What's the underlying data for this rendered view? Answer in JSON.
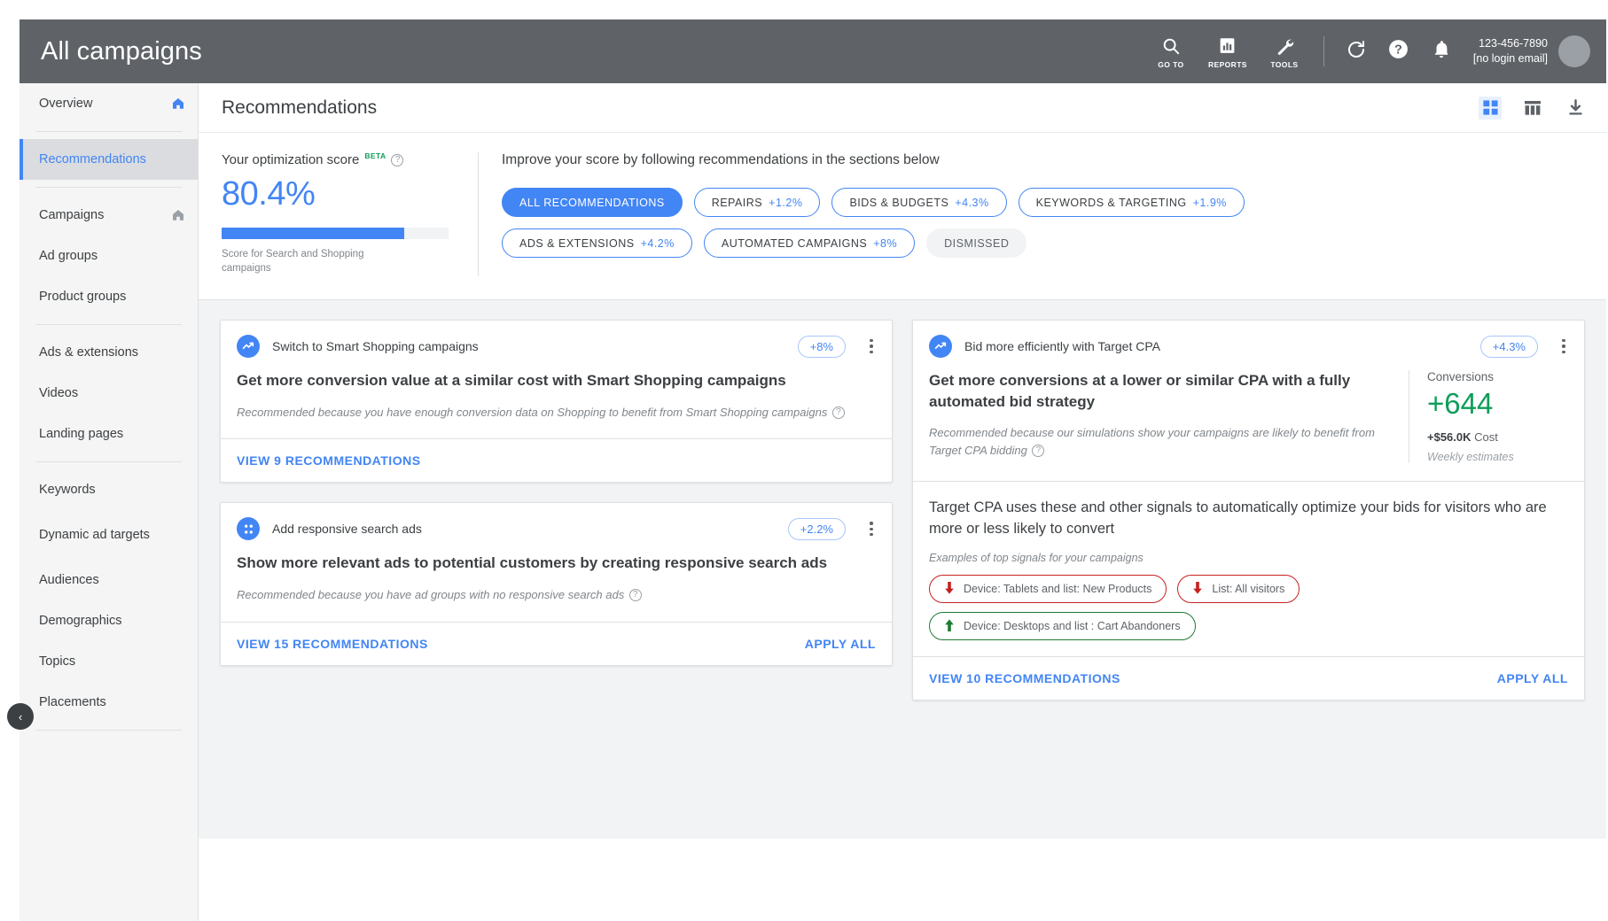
{
  "topbar": {
    "title": "All campaigns",
    "icon_buttons": [
      {
        "icon": "search-icon",
        "label": "GO TO"
      },
      {
        "icon": "reports-bar-chart-icon",
        "label": "REPORTS"
      },
      {
        "icon": "wrench-tools-icon",
        "label": "TOOLS"
      }
    ],
    "refresh_icon": "refresh-icon",
    "help_icon": "help-circle-icon",
    "notifications_icon": "bell-icon",
    "account_id": "123-456-7890",
    "account_email": "[no login email]"
  },
  "sidebar": {
    "items": [
      {
        "label": "Overview",
        "icon": "home-icon",
        "icon_active": true,
        "active": false,
        "sep_after": true
      },
      {
        "label": "Recommendations",
        "icon": "",
        "active": true,
        "sep_after": true
      },
      {
        "label": "Campaigns",
        "icon": "home-icon",
        "icon_active": false,
        "active": false
      },
      {
        "label": "Ad groups",
        "icon": "",
        "active": false
      },
      {
        "label": "Product groups",
        "icon": "",
        "active": false,
        "sep_after": true
      },
      {
        "label": "Ads & extensions",
        "icon": "",
        "active": false
      },
      {
        "label": "Videos",
        "icon": "",
        "active": false
      },
      {
        "label": "Landing pages",
        "icon": "",
        "active": false,
        "sep_after": true
      },
      {
        "label": "Keywords",
        "icon": "",
        "active": false
      },
      {
        "label": "Dynamic ad targets",
        "icon": "",
        "active": false,
        "tall": true
      },
      {
        "label": "Audiences",
        "icon": "",
        "active": false
      },
      {
        "label": "Demographics",
        "icon": "",
        "active": false
      },
      {
        "label": "Topics",
        "icon": "",
        "active": false
      },
      {
        "label": "Placements",
        "icon": "",
        "active": false,
        "sep_after": true
      }
    ],
    "collapse_toggle": "‹"
  },
  "page_header": {
    "title": "Recommendations",
    "actions": [
      {
        "name": "card-view-icon",
        "selected": true
      },
      {
        "name": "table-view-icon",
        "selected": false
      },
      {
        "name": "download-icon",
        "selected": false
      }
    ]
  },
  "score_panel": {
    "label": "Your optimization score",
    "beta": "BETA",
    "value": "80.4%",
    "progress_percent": 80.4,
    "caption": "Score for Search and Shopping campaigns",
    "improve_text": "Improve your score by following recommendations in the sections below",
    "chips": [
      {
        "label": "ALL RECOMMENDATIONS",
        "pct": "",
        "style": "primary",
        "row": 1
      },
      {
        "label": "REPAIRS",
        "pct": "+1.2%",
        "style": "outline",
        "row": 1
      },
      {
        "label": "BIDS & BUDGETS",
        "pct": "+4.3%",
        "style": "outline",
        "row": 1
      },
      {
        "label": "KEYWORDS & TARGETING",
        "pct": "+1.9%",
        "style": "outline",
        "row": 1
      },
      {
        "label": "ADS & EXTENSIONS",
        "pct": "+4.2%",
        "style": "outline",
        "row": 2
      },
      {
        "label": "AUTOMATED CAMPAIGNS",
        "pct": "+8%",
        "style": "outline",
        "row": 2
      },
      {
        "label": "DISMISSED",
        "pct": "",
        "style": "muted",
        "row": 2
      }
    ]
  },
  "cards": {
    "left": [
      {
        "type_icon": "trend-line-icon",
        "type_label": "Switch to Smart Shopping campaigns",
        "pct": "+8%",
        "headline": "Get more conversion value at a similar cost with Smart Shopping campaigns",
        "reason": "Recommended because you have enough conversion data on Shopping to benefit from Smart Shopping campaigns",
        "view_link": "VIEW 9 RECOMMENDATIONS",
        "apply_link": ""
      },
      {
        "type_icon": "grid-dots-icon",
        "type_label": "Add responsive search ads",
        "pct": "+2.2%",
        "headline": "Show more relevant ads to potential customers by creating responsive search ads",
        "reason": "Recommended because you have ad groups with no responsive search ads",
        "view_link": "VIEW 15 RECOMMENDATIONS",
        "apply_link": "APPLY ALL"
      }
    ],
    "right": [
      {
        "type_icon": "trend-line-icon",
        "type_label": "Bid more efficiently with Target CPA",
        "pct": "+4.3%",
        "headline": "Get more conversions at a lower or similar CPA with a fully automated bid strategy",
        "reason": "Recommended because our simulations show your campaigns are likely to benefit from Target CPA bidding",
        "metric": {
          "name": "Conversions",
          "value": "+644",
          "cost_value": "+$56.0K",
          "cost_label": "Cost",
          "note": "Weekly estimates",
          "value_color": "#0f9d58"
        },
        "section": {
          "title": "Target CPA uses these and other signals to automatically optimize your bids for visitors who are more or less likely to convert",
          "subtitle": "Examples of top signals for your campaigns",
          "signals": [
            {
              "label": "Device: Tablets and list: New Products",
              "direction": "down",
              "color": "#c5221f"
            },
            {
              "label": "List: All visitors",
              "direction": "down",
              "color": "#c5221f"
            },
            {
              "label": "Device: Desktops and list : Cart Abandoners",
              "direction": "up",
              "color": "#1e7b34"
            }
          ]
        },
        "view_link": "VIEW 10 RECOMMENDATIONS",
        "apply_link": "APPLY ALL"
      }
    ]
  },
  "colors": {
    "brand_blue": "#4285f4",
    "topbar_gray": "#5f6368",
    "green": "#0f9d58",
    "red": "#c5221f",
    "dark_green": "#1e7b34",
    "page_bg": "#f1f3f4"
  }
}
